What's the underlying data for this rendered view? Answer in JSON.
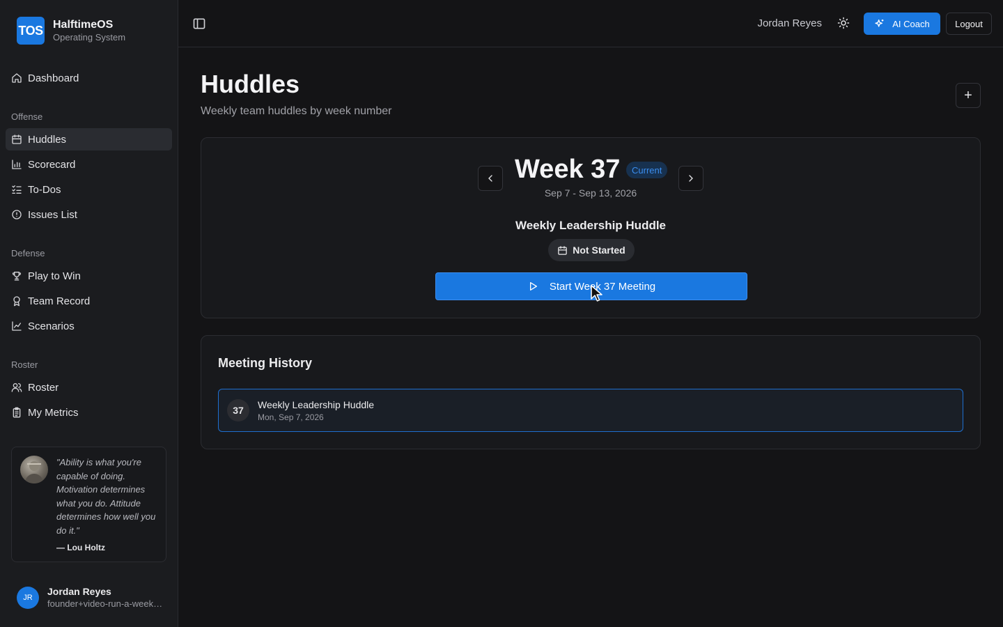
{
  "brand": {
    "logo": "TOS",
    "name": "HalftimeOS",
    "subtitle": "Operating System"
  },
  "sidebar": {
    "dashboard": {
      "label": "Dashboard",
      "icon": "home-icon"
    },
    "sections": [
      {
        "label": "Offense",
        "items": [
          {
            "label": "Huddles",
            "icon": "calendar-icon",
            "active": true
          },
          {
            "label": "Scorecard",
            "icon": "bar-chart-icon"
          },
          {
            "label": "To-Dos",
            "icon": "checklist-icon"
          },
          {
            "label": "Issues List",
            "icon": "alert-circle-icon"
          }
        ]
      },
      {
        "label": "Defense",
        "items": [
          {
            "label": "Play to Win",
            "icon": "trophy-icon"
          },
          {
            "label": "Team Record",
            "icon": "award-icon"
          },
          {
            "label": "Scenarios",
            "icon": "line-chart-icon"
          }
        ]
      },
      {
        "label": "Roster",
        "items": [
          {
            "label": "Roster",
            "icon": "users-icon"
          },
          {
            "label": "My Metrics",
            "icon": "clipboard-icon"
          }
        ]
      }
    ],
    "quote": {
      "text": "\"Ability is what you're capable of doing. Motivation determines what you do. Attitude determines how well you do it.\"",
      "author": "— Lou Holtz"
    },
    "user": {
      "initials": "JR",
      "name": "Jordan Reyes",
      "email": "founder+video-run-a-week-ahead@halftimeos.com"
    }
  },
  "topbar": {
    "user_name": "Jordan Reyes",
    "ai_coach_label": "AI Coach",
    "logout_label": "Logout"
  },
  "page": {
    "title": "Huddles",
    "subtitle": "Weekly team huddles by week number",
    "add_label": "+"
  },
  "week": {
    "title": "Week 37",
    "badge": "Current",
    "dates": "Sep 7 - Sep 13, 2026",
    "meeting_name": "Weekly Leadership Huddle",
    "status": "Not Started",
    "start_label": "Start Week 37 Meeting"
  },
  "history": {
    "title": "Meeting History",
    "rows": [
      {
        "week": "37",
        "title": "Weekly Leadership Huddle",
        "date": "Mon, Sep 7, 2026"
      }
    ]
  },
  "colors": {
    "accent": "#1a78e0",
    "background": "#141416",
    "sidebar": "#1b1c1f"
  }
}
